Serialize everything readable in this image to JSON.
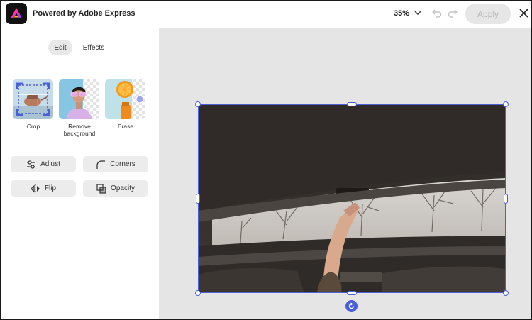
{
  "header": {
    "title": "Powered by Adobe Express",
    "zoom": "35%",
    "apply_label": "Apply",
    "logo_icon": "adobe-express-logo",
    "undo_icon": "undo-icon",
    "redo_icon": "redo-icon",
    "close_icon": "close-icon"
  },
  "tabs": [
    {
      "label": "Edit",
      "active": true
    },
    {
      "label": "Effects",
      "active": false
    }
  ],
  "tools": [
    {
      "label": "Crop"
    },
    {
      "label": "Remove background"
    },
    {
      "label": "Erase"
    }
  ],
  "actions": {
    "adjust": "Adjust",
    "corners": "Corners",
    "flip": "Flip",
    "opacity": "Opacity"
  },
  "colors": {
    "accent": "#4b5fd6",
    "canvas_bg": "#e5e5e5",
    "button_bg": "#ececec"
  }
}
